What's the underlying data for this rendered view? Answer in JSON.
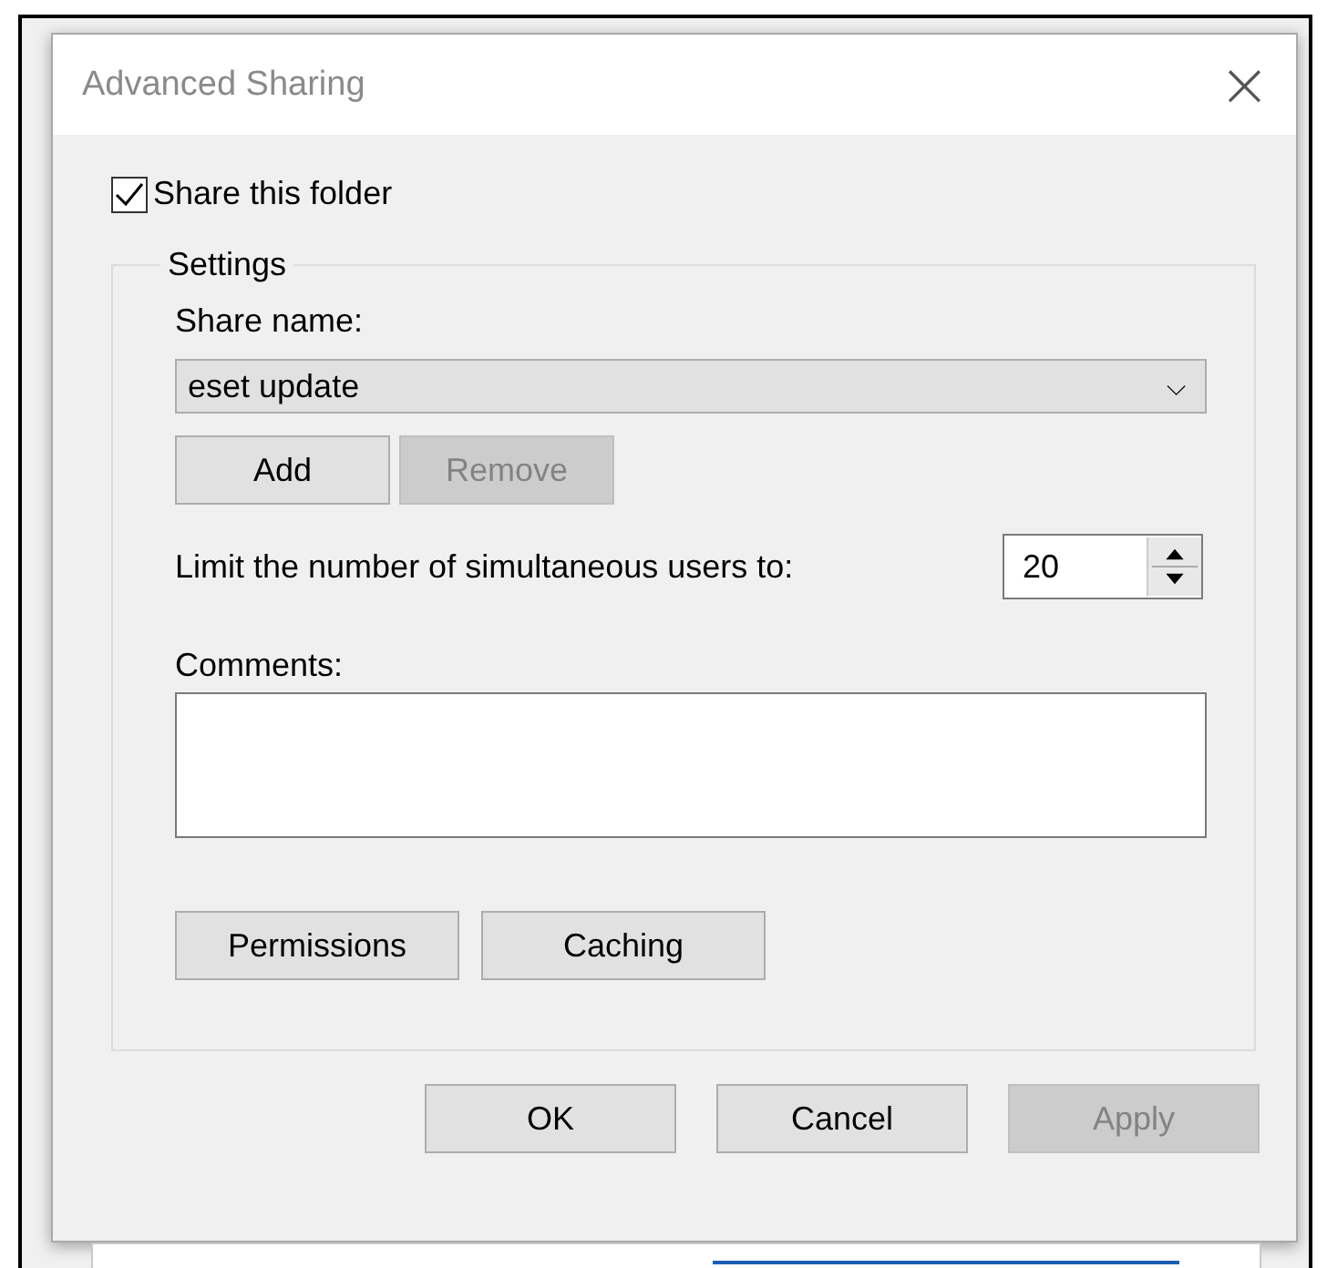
{
  "window": {
    "title": "Advanced Sharing",
    "close": "×"
  },
  "share_folder": {
    "label": "Share this folder",
    "checked": true
  },
  "settings": {
    "legend": "Settings",
    "share_name_label": "Share name:",
    "share_name": {
      "value": "eset update",
      "arrow": "⌵"
    },
    "share_buttons": [
      {
        "label": "Add",
        "disabled": false
      },
      {
        "label": "Remove",
        "disabled": true
      }
    ],
    "limit_label": "Limit the number of simultaneous users to:",
    "limit_value": "20",
    "comments_label": "Comments:",
    "buttons": [
      {
        "label": "Permissions",
        "disabled": false
      },
      {
        "label": "Caching",
        "disabled": false
      }
    ]
  },
  "buttons": [
    {
      "label": "OK",
      "disabled": false
    },
    {
      "label": "Cancel",
      "disabled": false
    },
    {
      "label": "Apply",
      "disabled": true
    }
  ]
}
